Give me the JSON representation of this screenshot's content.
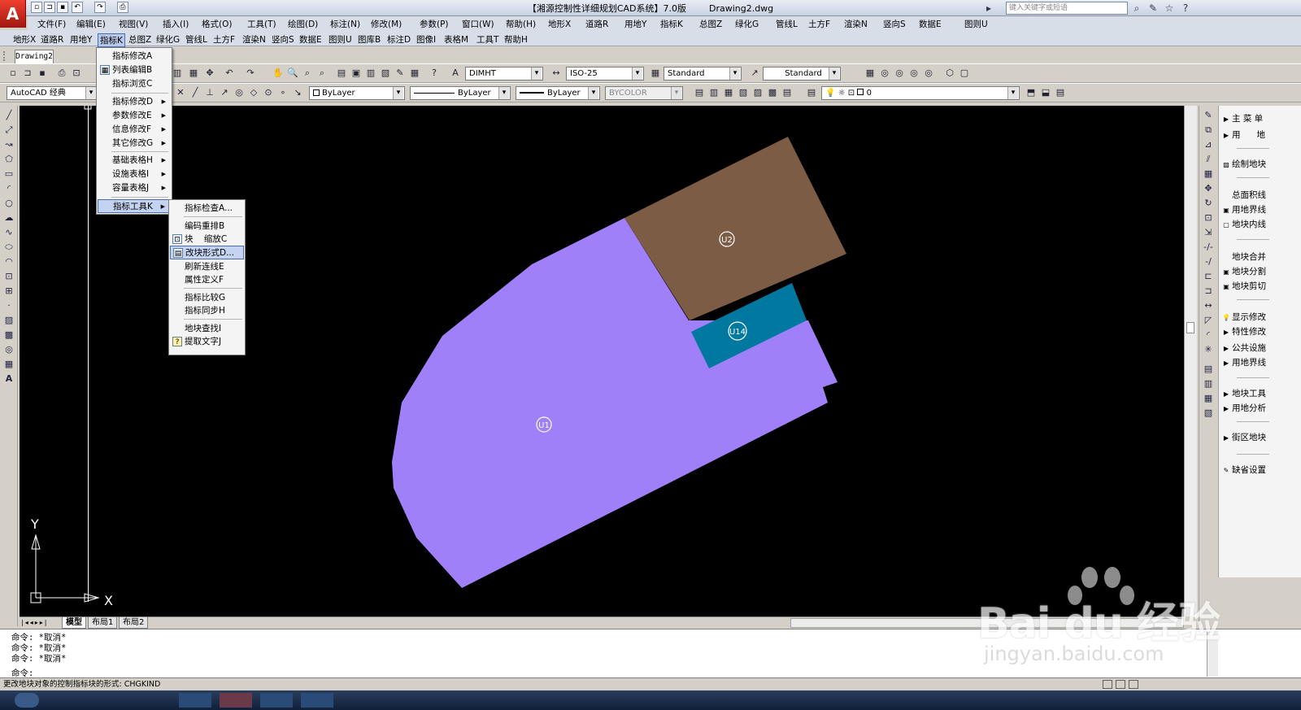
{
  "app": {
    "logo": "A",
    "title": "【湘源控制性详细规划CAD系统】7.0版        Drawing2.dwg",
    "search_placeholder": "键入关键字或短语"
  },
  "menubar1": [
    "文件(F)",
    "编辑(E)",
    "视图(V)",
    "插入(I)",
    "格式(O)",
    "工具(T)",
    "绘图(D)",
    "标注(N)",
    "修改(M)",
    "参数(P)",
    "窗口(W)",
    "帮助(H)",
    "地形X",
    "道路R",
    "用地Y",
    "指标K",
    "总图Z",
    "绿化G",
    "管线L",
    "土方F",
    "渲染N",
    "竖向S",
    "数据E",
    "图则U"
  ],
  "menubar2": [
    "地形X",
    "道路R",
    "用地Y",
    "指标K",
    "总图Z",
    "绿化G",
    "管线L",
    "土方F",
    "渲染N",
    "竖向S",
    "数据E",
    "图则U",
    "图库B",
    "标注D",
    "图像I",
    "表格M",
    "工具T",
    "帮助H"
  ],
  "doc_tab": "Drawing2",
  "toolbar": {
    "text_style": "DIMHT",
    "dim_style": "ISO-25",
    "table_style": "Standard",
    "mleader_style": "Standard",
    "workspace": "AutoCAD 经典",
    "color": "ByLayer",
    "linetype": "ByLayer",
    "lineweight": "ByLayer",
    "plotstyle": "BYCOLOR",
    "layer": "0"
  },
  "menu_k": {
    "items": [
      "指标修改A",
      "列表编辑B",
      "指标浏览C",
      "指标修改D",
      "参数修改E",
      "信息修改F",
      "其它修改G",
      "基础表格H",
      "设施表格I",
      "容量表格J",
      "指标工具K"
    ]
  },
  "submenu_tools": {
    "items": [
      "指标检查A...",
      "编码重排B",
      "块    缩放C",
      "改块形式D...",
      "刷新连线E",
      "属性定义F",
      "指标比较G",
      "指标同步H",
      "地块查找I",
      "提取文字J"
    ]
  },
  "drawing": {
    "colors": {
      "purple": "#a080f8",
      "brown": "#7c5c44",
      "teal": "#0078a0"
    },
    "labels": {
      "u1": "U1",
      "u2": "U2",
      "u14": "U14"
    },
    "axis_y": "Y",
    "axis_x": "X"
  },
  "layout_tabs": [
    "模型",
    "布局1",
    "布局2"
  ],
  "command": {
    "history": [
      "命令: *取消*",
      "命令: *取消*",
      "命令: *取消*"
    ],
    "prompt": "命令:"
  },
  "status_text": "更改地块对象的控制指标块的形式: CHGKIND",
  "right_panel": {
    "items": [
      "主 菜 单",
      "用      地",
      "绘制地块",
      "总面积线",
      "用地界线",
      "地块内线",
      "地块合并",
      "地块分割",
      "地块剪切",
      "显示修改",
      "特性修改",
      "公共设施",
      "用地界线",
      "地块工具",
      "用地分析",
      "街区地块",
      "缺省设置"
    ]
  },
  "watermark": {
    "brand": "Bai du 经验",
    "url": "jingyan.baidu.com"
  }
}
